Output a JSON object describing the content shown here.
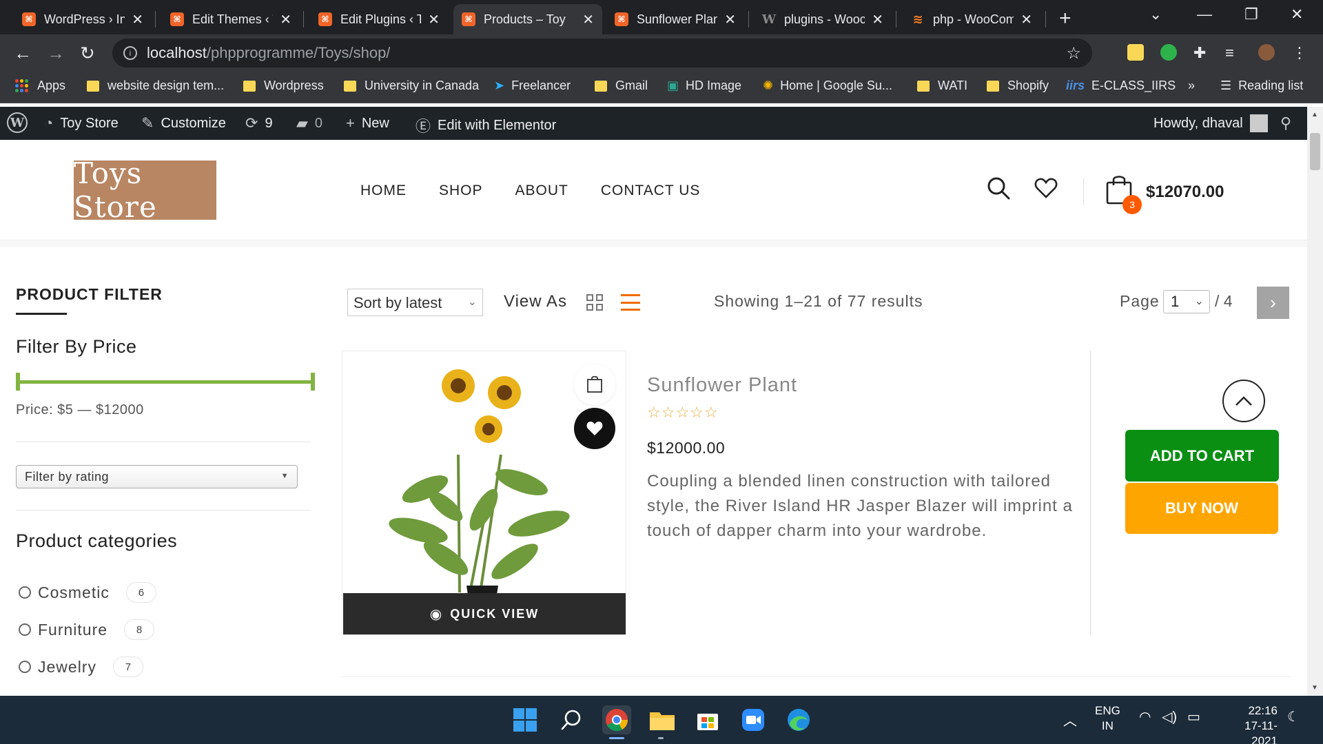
{
  "browser": {
    "tabs": [
      {
        "label": "WordPress › Ins",
        "icon": "xampp-icon"
      },
      {
        "label": "Edit Themes ‹ T",
        "icon": "xampp-icon"
      },
      {
        "label": "Edit Plugins ‹ T",
        "icon": "xampp-icon"
      },
      {
        "label": "Products – Toy",
        "icon": "xampp-icon",
        "active": true
      },
      {
        "label": "Sunflower Plan",
        "icon": "xampp-icon"
      },
      {
        "label": "plugins - Wooc",
        "icon": "wikipedia-icon"
      },
      {
        "label": "php - WooCom",
        "icon": "stackoverflow-icon"
      }
    ],
    "url_host": "localhost",
    "url_path": "/phpprogramme/Toys/shop/",
    "bookmarks": [
      {
        "label": "Apps"
      },
      {
        "label": "website design tem..."
      },
      {
        "label": "Wordpress"
      },
      {
        "label": "University in Canada"
      },
      {
        "label": "Freelancer"
      },
      {
        "label": "Gmail"
      },
      {
        "label": "HD Image"
      },
      {
        "label": "Home | Google Su..."
      },
      {
        "label": "WATI"
      },
      {
        "label": "Shopify"
      },
      {
        "label": "E-CLASS_IIRS"
      }
    ],
    "bookmarks_more": "»",
    "reading_list": "Reading list"
  },
  "admin_bar": {
    "site_name": "Toy Store",
    "customize": "Customize",
    "updates_count": "9",
    "comments_count": "0",
    "new": "New",
    "elementor": "Edit with Elementor",
    "howdy": "Howdy, dhaval"
  },
  "header": {
    "logo_text": "Toys Store",
    "nav": [
      "HOME",
      "SHOP",
      "ABOUT",
      "CONTACT US"
    ],
    "cart_count": "3",
    "cart_total": "$12070.00"
  },
  "sidebar": {
    "title": "PRODUCT FILTER",
    "price_heading": "Filter By Price",
    "price_text": "Price: $5 — $12000",
    "rating_select": "Filter by rating",
    "categories_heading": "Product categories",
    "categories": [
      {
        "name": "Cosmetic",
        "count": "6"
      },
      {
        "name": "Furniture",
        "count": "8"
      },
      {
        "name": "Jewelry",
        "count": "7"
      }
    ]
  },
  "toolbar": {
    "sort": "Sort by latest",
    "view_as": "View As",
    "showing": "Showing 1–21 of 77 results",
    "page_label": "Page",
    "page_current": "1",
    "page_total": "/ 4"
  },
  "product": {
    "name": "Sunflower Plant",
    "stars": "☆☆☆☆☆",
    "price": "$12000.00",
    "description": "Coupling a blended linen construction with tailored style, the River Island HR Jasper Blazer will imprint a touch of dapper charm into your wardrobe.",
    "quick_view": "QUICK VIEW",
    "add_to_cart": "ADD TO CART",
    "buy_now": "BUY NOW"
  },
  "taskbar": {
    "lang_top": "ENG",
    "lang_bottom": "IN",
    "time": "22:16",
    "date": "17-11-2021"
  },
  "colors": {
    "accent_green": "#0a8f13",
    "accent_orange": "#ffa500",
    "badge_orange": "#ff5a00",
    "range_green": "#81b441",
    "logo_bg": "#b88662"
  }
}
